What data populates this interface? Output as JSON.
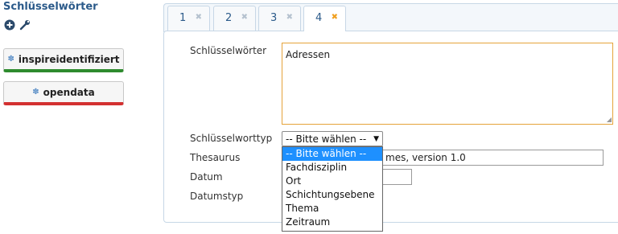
{
  "sidebar": {
    "title": "Schlüsselwörter",
    "icons": [
      "plus-circle-icon",
      "wrench-icon"
    ],
    "keyword_buttons": [
      {
        "label": "inspireidentifiziert",
        "color": "#2e8b2e"
      },
      {
        "label": "opendata",
        "color": "#d33030"
      }
    ]
  },
  "tabs": [
    {
      "label": "1",
      "active": false
    },
    {
      "label": "2",
      "active": false
    },
    {
      "label": "3",
      "active": false
    },
    {
      "label": "4",
      "active": true
    }
  ],
  "form": {
    "keywords_label": "Schlüsselwörter",
    "keywords_value": "Adressen",
    "type_label": "Schlüsselworttyp",
    "type_selected": "-- Bitte wählen --",
    "thesaurus_label": "Thesaurus",
    "thesaurus_visible_value": "mes, version 1.0",
    "date_label": "Datum",
    "date_value": "",
    "date_type_label": "Datumstyp"
  },
  "dropdown": {
    "options": [
      "-- Bitte wählen --",
      "Fachdisziplin",
      "Ort",
      "Schichtungsebene",
      "Thema",
      "Zeitraum"
    ],
    "highlighted_index": 0
  },
  "colors": {
    "accent": "#2b5a8a",
    "active_tab_close": "#f0a020",
    "focus_border": "#e5a33a",
    "highlight": "#1e90ff"
  }
}
